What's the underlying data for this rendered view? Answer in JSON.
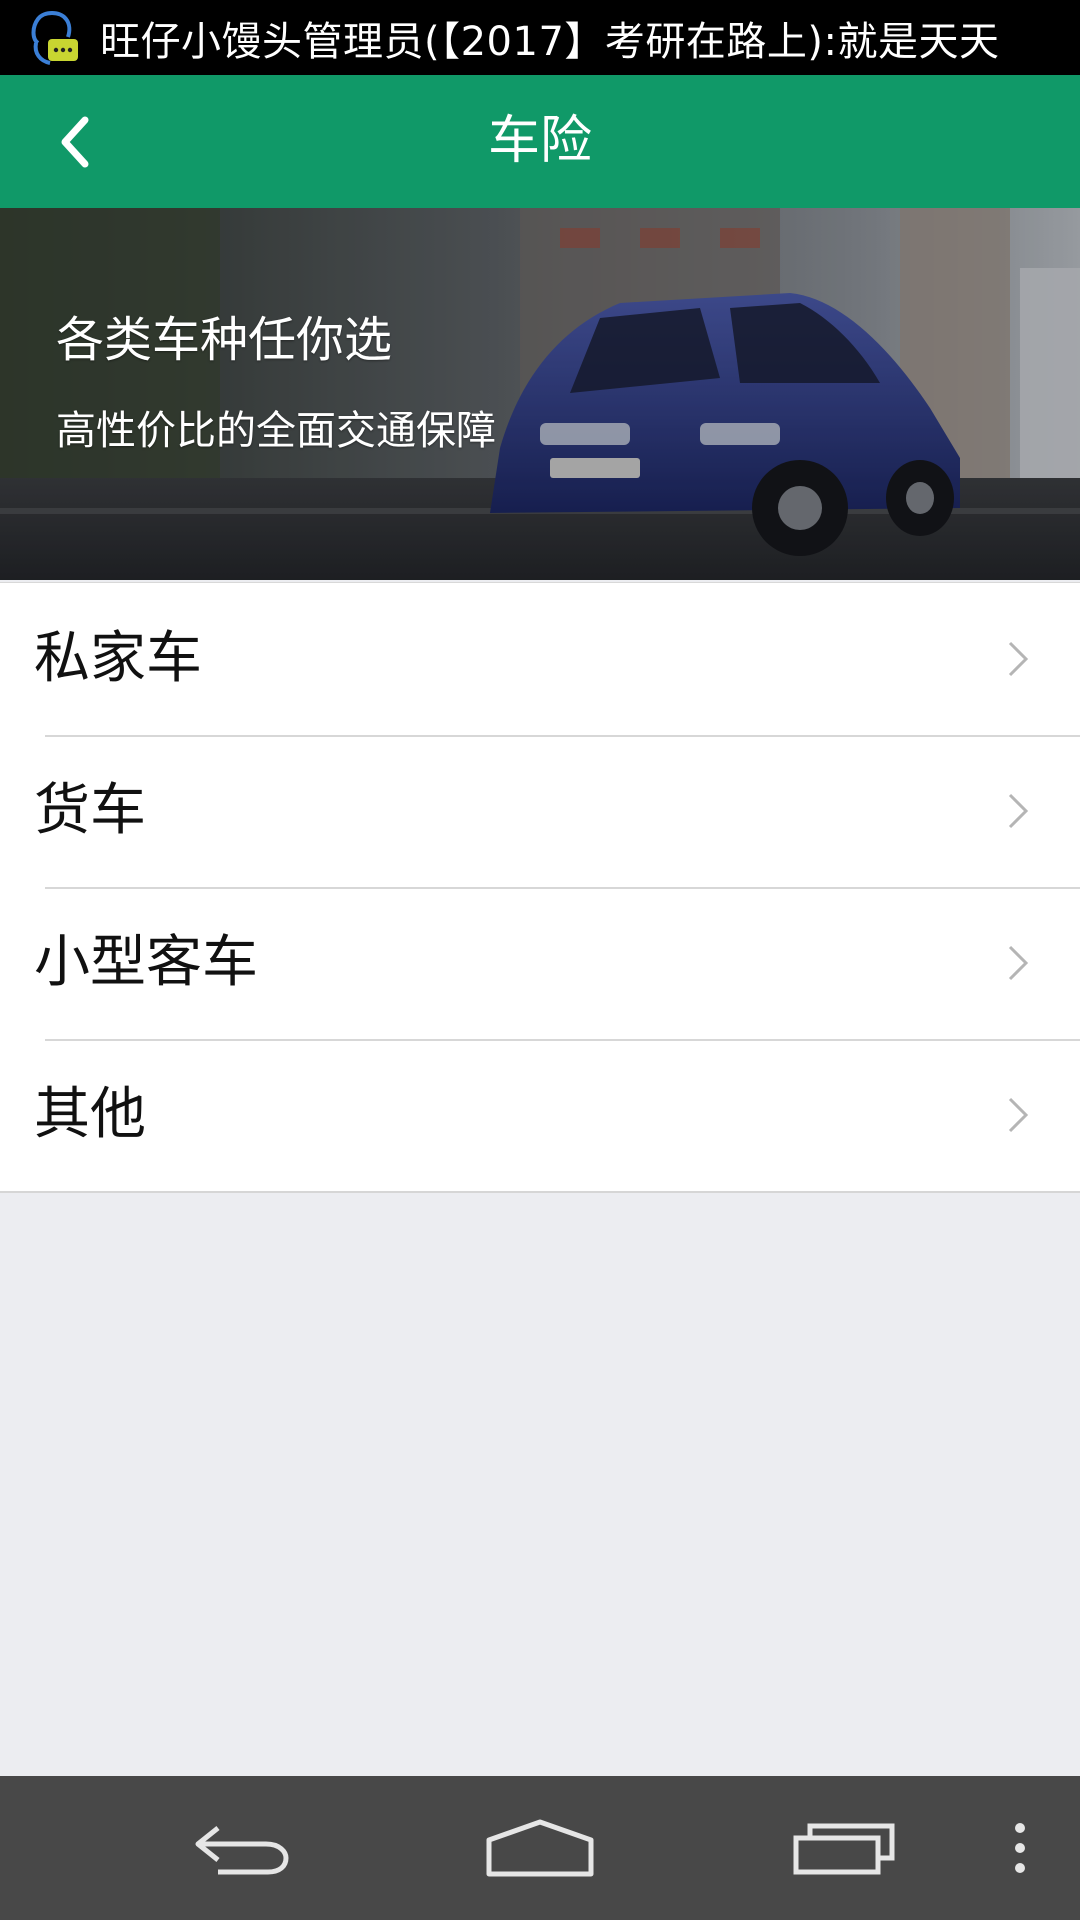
{
  "status_bar": {
    "notification_icon": "qq-chat-icon",
    "notification_text": "旺仔小馒头管理员(【2017】考研在路上):就是天天"
  },
  "app_bar": {
    "title": "车险",
    "back_icon": "chevron-left-icon"
  },
  "banner": {
    "title": "各类车种任你选",
    "subtitle": "高性价比的全面交通保障"
  },
  "list": {
    "items": [
      {
        "label": "私家车",
        "icon": "chevron-right-icon"
      },
      {
        "label": "货车",
        "icon": "chevron-right-icon"
      },
      {
        "label": "小型客车",
        "icon": "chevron-right-icon"
      },
      {
        "label": "其他",
        "icon": "chevron-right-icon"
      }
    ]
  },
  "nav_bar": {
    "buttons": [
      "back-icon",
      "home-icon",
      "recents-icon",
      "overflow-menu-icon"
    ]
  },
  "colors": {
    "app_bar": "#109968",
    "background": "#ecedf1",
    "nav_bar": "#484848"
  }
}
